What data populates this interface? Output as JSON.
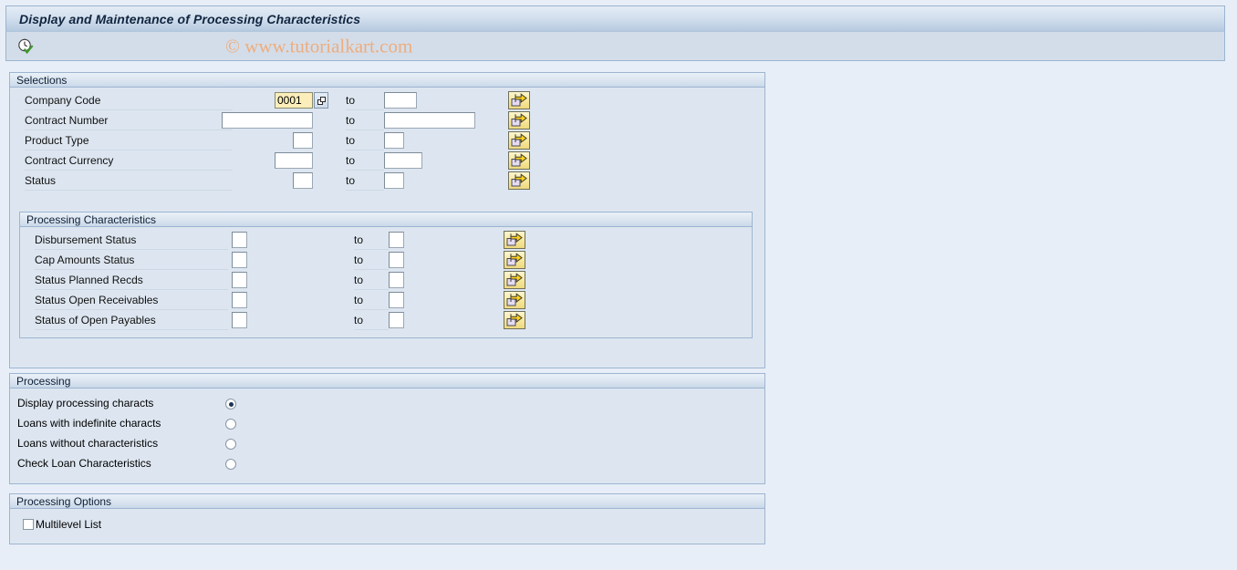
{
  "window": {
    "title": "Display and Maintenance of Processing Characteristics",
    "watermark": "© www.tutorialkart.com"
  },
  "toolbar": {
    "execute_icon": "clock-check-icon",
    "execute_tooltip": "Execute"
  },
  "selections": {
    "header": "Selections",
    "to_label": "to",
    "rows": [
      {
        "label": "Company Code",
        "from_value": "0001",
        "from_width": 42,
        "to_value": "",
        "to_width": 36,
        "has_f4": true,
        "arrow_icon": "multiple-selection-icon"
      },
      {
        "label": "Contract Number",
        "from_value": "",
        "from_width": 100,
        "to_value": "",
        "to_width": 100,
        "has_f4": false,
        "arrow_icon": "multiple-selection-icon"
      },
      {
        "label": "Product Type",
        "from_value": "",
        "from_width": 22,
        "to_value": "",
        "to_width": 22,
        "has_f4": false,
        "arrow_icon": "multiple-selection-icon"
      },
      {
        "label": "Contract Currency",
        "from_value": "",
        "from_width": 42,
        "to_value": "",
        "to_width": 42,
        "has_f4": false,
        "arrow_icon": "multiple-selection-icon"
      },
      {
        "label": "Status",
        "from_value": "",
        "from_width": 22,
        "to_value": "",
        "to_width": 22,
        "has_f4": false,
        "arrow_icon": "multiple-selection-icon"
      }
    ]
  },
  "processing_characteristics": {
    "header": "Processing Characteristics",
    "to_label": "to",
    "rows": [
      {
        "label": "Disbursement Status",
        "from_value": "",
        "to_value": "",
        "arrow_icon": "multiple-selection-icon"
      },
      {
        "label": "Cap Amounts Status",
        "from_value": "",
        "to_value": "",
        "arrow_icon": "multiple-selection-icon"
      },
      {
        "label": "Status Planned Recds",
        "from_value": "",
        "to_value": "",
        "arrow_icon": "multiple-selection-icon"
      },
      {
        "label": "Status Open Receivables",
        "from_value": "",
        "to_value": "",
        "arrow_icon": "multiple-selection-icon"
      },
      {
        "label": "Status of Open Payables",
        "from_value": "",
        "to_value": "",
        "arrow_icon": "multiple-selection-icon"
      }
    ]
  },
  "processing": {
    "header": "Processing",
    "options": [
      {
        "label": "Display processing characts",
        "selected": true
      },
      {
        "label": "Loans with indefinite characts",
        "selected": false
      },
      {
        "label": "Loans without characteristics",
        "selected": false
      },
      {
        "label": "Check Loan Characteristics",
        "selected": false
      }
    ]
  },
  "processing_options": {
    "header": "Processing Options",
    "checkboxes": [
      {
        "label": "Multilevel List",
        "checked": false
      }
    ]
  },
  "colors": {
    "page_background": "#e8eef7",
    "panel_background": "#dde6f0",
    "panel_border": "#9db5d2",
    "title_text": "#10253f",
    "watermark": "#edad7e",
    "field_filled": "#fbeeba",
    "button_yellow": "#f7e79a",
    "radio_dot": "#1d3557"
  }
}
